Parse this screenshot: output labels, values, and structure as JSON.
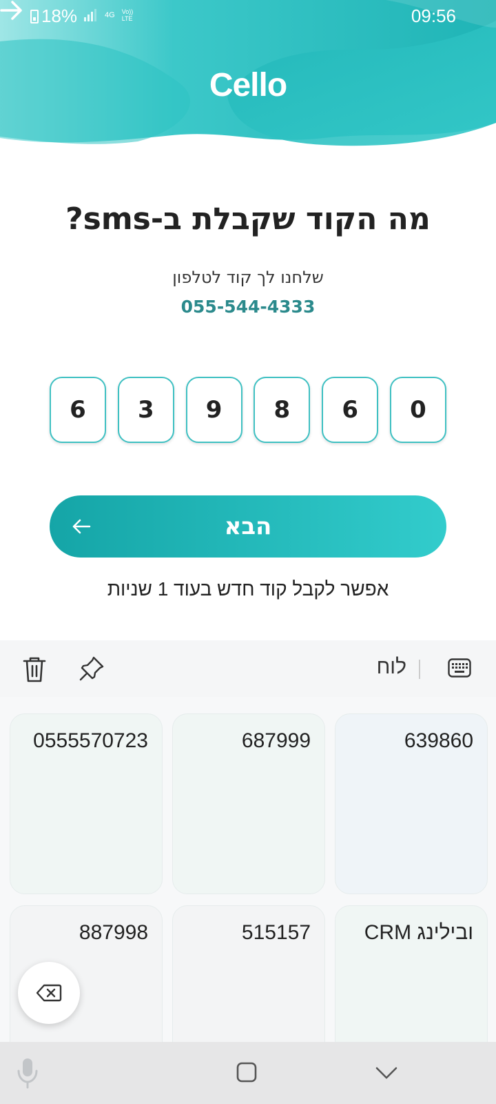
{
  "status_bar": {
    "battery": "18%",
    "network": "4G",
    "volte_top": "Vo))",
    "volte_bottom": "LTE",
    "time": "09:56"
  },
  "header": {
    "logo": "Cello",
    "back_icon": "arrow-right-icon"
  },
  "main": {
    "title": "מה הקוד שקבלת ב-sms?",
    "subtitle": "שלחנו לך קוד לטלפון",
    "phone": "055-544-4333",
    "code_digits": [
      "6",
      "3",
      "9",
      "8",
      "6",
      "0"
    ],
    "next_label": "הבא",
    "resend_text": "אפשר לקבל קוד חדש בעוד 1 שניות"
  },
  "keyboard": {
    "board_label": "לוח",
    "clipboard_items": [
      "639860",
      "687999",
      "0555570723",
      "CRM ובילינג",
      "515157",
      "887998"
    ]
  },
  "colors": {
    "accent": "#22b6b8",
    "accent_dark": "#15a5a7",
    "phone_text": "#2b8a8c"
  }
}
